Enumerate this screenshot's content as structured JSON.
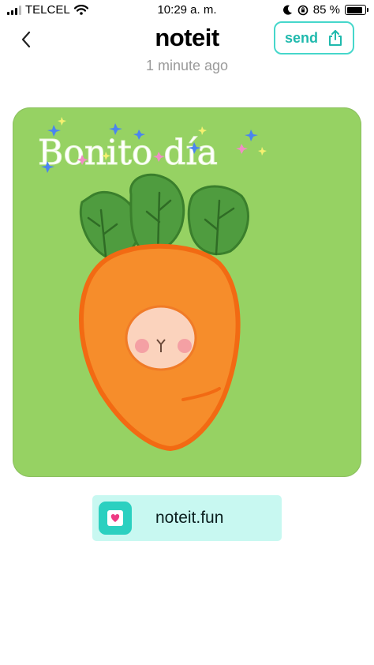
{
  "status_bar": {
    "carrier": "TELCEL",
    "time": "10:29 a. m.",
    "battery": "85 %",
    "battery_level": 0.85,
    "icons": [
      "signal-icon",
      "wifi-icon",
      "moon-icon",
      "orientation-lock-icon",
      "battery-icon"
    ]
  },
  "header": {
    "title": "noteit",
    "subtitle": "1 minute ago",
    "send_label": "send",
    "accent_color": "#46d7cb"
  },
  "note": {
    "drawing_text": "Bonito día",
    "background_color": "#96d263"
  },
  "footer": {
    "link_label": "noteit.fun",
    "link_bg": "#c8f8f1"
  }
}
